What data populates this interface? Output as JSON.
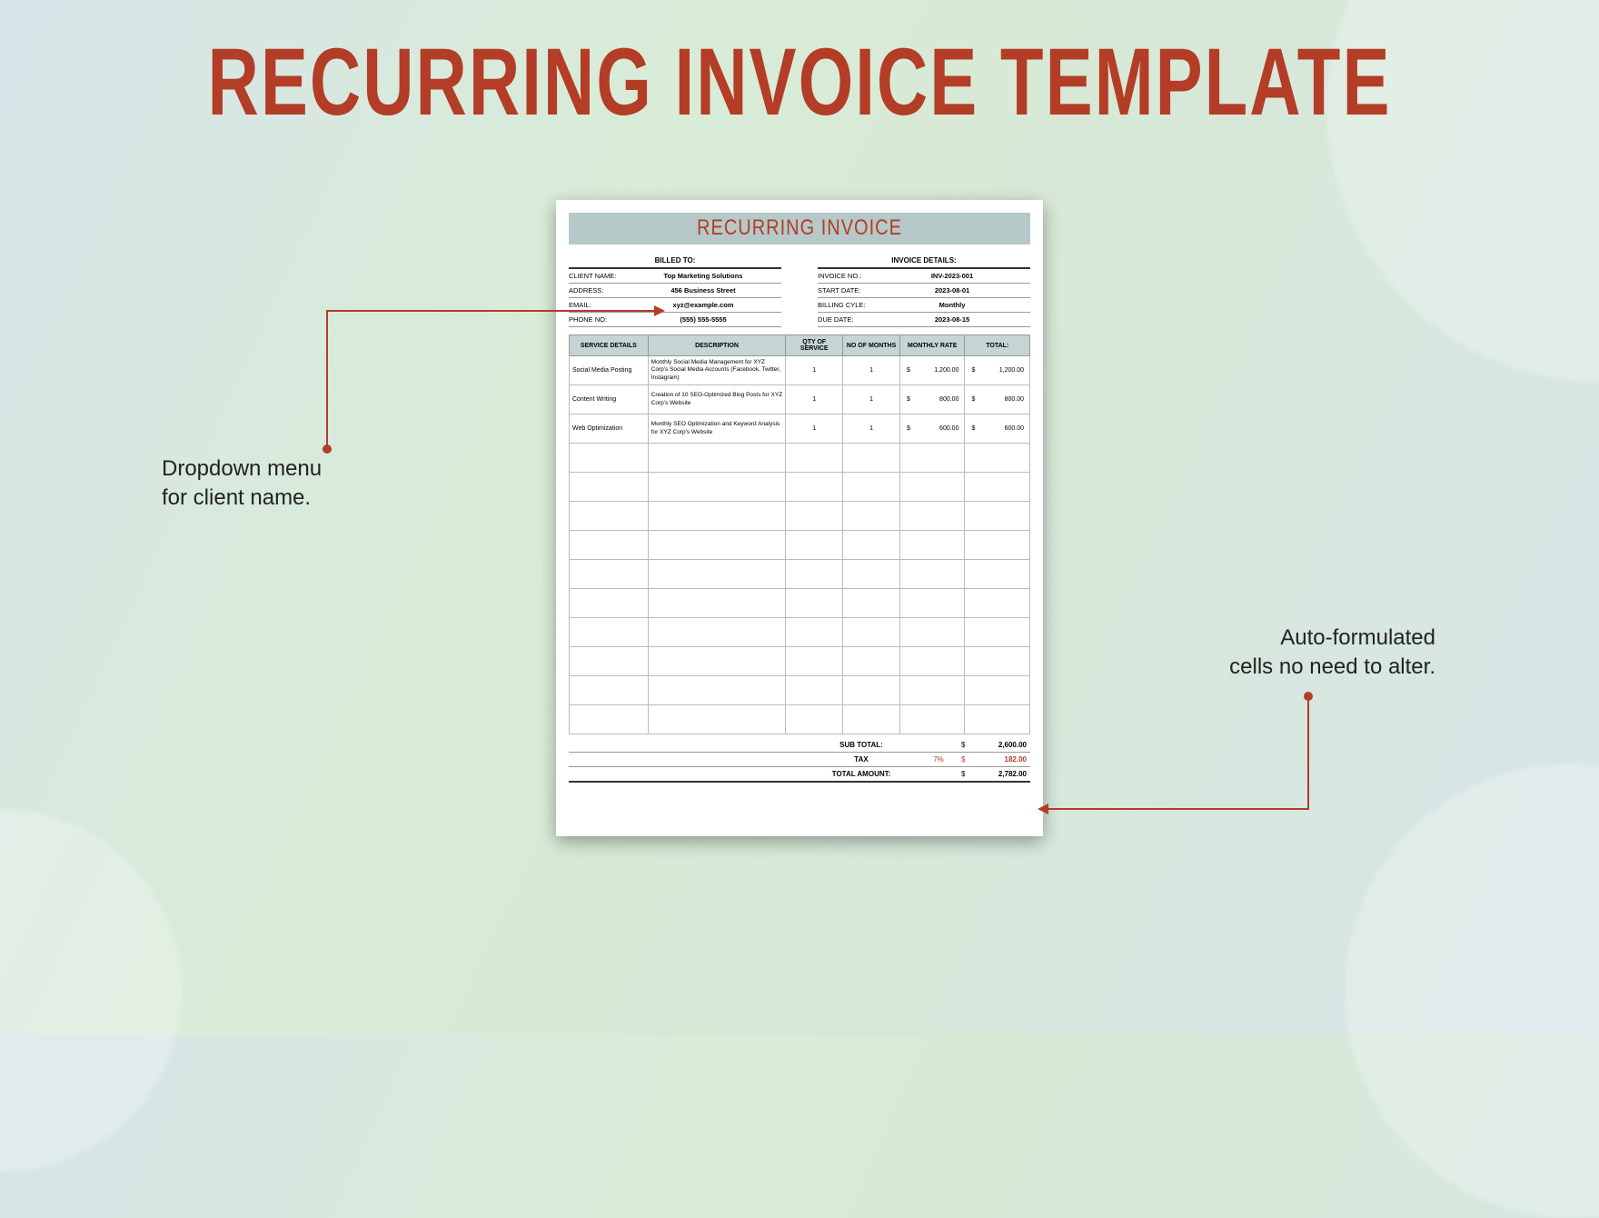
{
  "page_title": "RECURRING INVOICE TEMPLATE",
  "doc_title": "RECURRING INVOICE",
  "billed_to_header": "BILLED TO:",
  "invoice_details_header": "INVOICE DETAILS:",
  "client": {
    "name_label": "CLIENT NAME:",
    "name": "Top Marketing Solutions",
    "address_label": "ADDRESS:",
    "address": "456 Business Street",
    "email_label": "EMAIL:",
    "email": "xyz@example.com",
    "phone_label": "PHONE NO:",
    "phone": "(555) 555-5555"
  },
  "invoice": {
    "no_label": "INVOICE NO.:",
    "no": "INV-2023-001",
    "start_label": "START DATE:",
    "start": "2023-08-01",
    "cycle_label": "BILLING CYLE:",
    "cycle": "Monthly",
    "due_label": "DUE DATE:",
    "due": "2023-08-15"
  },
  "columns": {
    "service": "SERVICE DETAILS",
    "desc": "DESCRIPTION",
    "qty": "QTY OF SERVICE",
    "months": "NO OF MONTHS",
    "rate": "MONTHLY RATE",
    "total": "TOTAL:"
  },
  "rows": [
    {
      "service": "Social Media Posting",
      "desc": "Monthly Social Media Management for XYZ Corp's Social Media Accounts (Facebook, Twitter, Instagram)",
      "qty": "1",
      "months": "1",
      "rate": "1,200.00",
      "total": "1,200.00"
    },
    {
      "service": "Content Writing",
      "desc": "Creation of 10 SEO-Optimized Blog Posts for XYZ Corp's Website",
      "qty": "1",
      "months": "1",
      "rate": "800.00",
      "total": "800.00"
    },
    {
      "service": "Web Optimization",
      "desc": "Monthly SEO Optimization and Keyword Analysis for XYZ Corp's Website",
      "qty": "1",
      "months": "1",
      "rate": "600.00",
      "total": "600.00"
    }
  ],
  "totals": {
    "subtotal_label": "SUB TOTAL:",
    "subtotal": "2,600.00",
    "tax_label": "TAX",
    "tax_pct": "7%",
    "tax": "182.00",
    "total_label": "TOTAL AMOUNT:",
    "total": "2,782.00",
    "currency": "$"
  },
  "callout_left_l1": "Dropdown menu",
  "callout_left_l2": "for client name.",
  "callout_right_l1": "Auto-formulated",
  "callout_right_l2": "cells no need to alter."
}
